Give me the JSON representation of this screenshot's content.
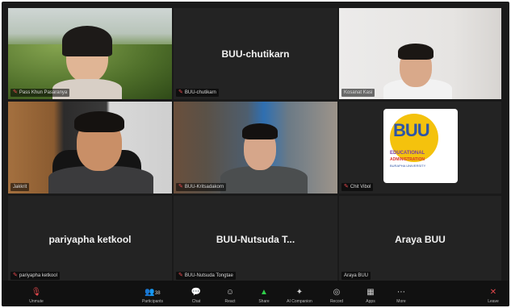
{
  "participants": [
    {
      "id": "p1",
      "label": "Pass Khun Pasaranya",
      "type": "video-landscape"
    },
    {
      "id": "p2",
      "label": "BUU-chutikarn",
      "name_display": "BUU-chutikarn",
      "tag": "BUU-chutikarn",
      "type": "name"
    },
    {
      "id": "p3",
      "label": "Kosanat Kasi",
      "type": "video-man"
    },
    {
      "id": "p4",
      "label": "Jakkrit",
      "type": "video-man-active"
    },
    {
      "id": "p5",
      "label": "BUU-Kritsadakorn",
      "type": "video-man-office"
    },
    {
      "id": "p6",
      "label": "Chit Vibol",
      "type": "logo"
    },
    {
      "id": "p7",
      "label": "pariyapha ketkool",
      "name_display": "pariyapha ketkool",
      "tag": "pariyapha ketkool",
      "type": "name"
    },
    {
      "id": "p8",
      "label": "BUU-Nutsuda Tongtae",
      "name_display": "BUU-Nutsuda T...",
      "tag": "BUU-Nutsuda Tongtae",
      "type": "name"
    },
    {
      "id": "p9",
      "label": "Araya BUU",
      "name_display": "Araya BUU",
      "tag": "Araya BUU",
      "type": "name"
    }
  ],
  "logo": {
    "text": "BUU",
    "line1": "EDUCATIONAL",
    "line2": "ADMINISTRATION",
    "line3": "BURAPHA UNIVERSITY",
    "colors": {
      "yellow": "#f4c20d",
      "blue": "#2e55a5",
      "red": "#d9342b",
      "purple": "#7b3fa0"
    }
  },
  "toolbar": {
    "items": [
      {
        "name": "mute",
        "label": "Unmute",
        "icon": "mic-muted-icon",
        "glyph": "🎙"
      },
      {
        "name": "participants",
        "label": "Participants",
        "icon": "participants-icon",
        "glyph": "👥",
        "count": "38"
      },
      {
        "name": "chat",
        "label": "Chat",
        "icon": "chat-icon",
        "glyph": "💬"
      },
      {
        "name": "react",
        "label": "React",
        "icon": "react-icon",
        "glyph": "☺"
      },
      {
        "name": "share",
        "label": "Share",
        "icon": "share-icon",
        "glyph": "▲"
      },
      {
        "name": "summary",
        "label": "AI Companion",
        "icon": "ai-icon",
        "glyph": "✦"
      },
      {
        "name": "record",
        "label": "Record",
        "icon": "record-icon",
        "glyph": "◎"
      },
      {
        "name": "apps",
        "label": "Apps",
        "icon": "apps-icon",
        "glyph": "▦"
      },
      {
        "name": "more",
        "label": "More",
        "icon": "more-icon",
        "glyph": "⋯"
      },
      {
        "name": "leave",
        "label": "Leave",
        "icon": "leave-icon",
        "glyph": "✕"
      }
    ]
  },
  "colors": {
    "accent": "#37c346",
    "muted": "#e5484d",
    "bg": "#1a1a1a",
    "tile": "#232323"
  }
}
